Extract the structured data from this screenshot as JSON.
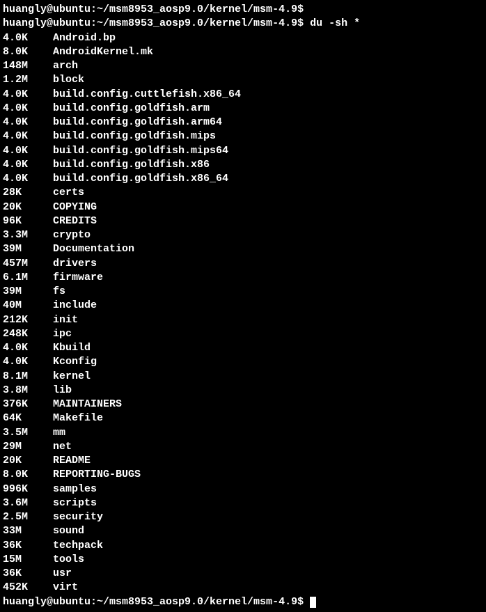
{
  "prompt1": "huangly@ubuntu:~/msm8953_aosp9.0/kernel/msm-4.9$ ",
  "prompt2": "huangly@ubuntu:~/msm8953_aosp9.0/kernel/msm-4.9$ ",
  "command": "du -sh *",
  "prompt3": "huangly@ubuntu:~/msm8953_aosp9.0/kernel/msm-4.9$ ",
  "entries": [
    {
      "size": "4.0K",
      "name": "Android.bp"
    },
    {
      "size": "8.0K",
      "name": "AndroidKernel.mk"
    },
    {
      "size": "148M",
      "name": "arch"
    },
    {
      "size": "1.2M",
      "name": "block"
    },
    {
      "size": "4.0K",
      "name": "build.config.cuttlefish.x86_64"
    },
    {
      "size": "4.0K",
      "name": "build.config.goldfish.arm"
    },
    {
      "size": "4.0K",
      "name": "build.config.goldfish.arm64"
    },
    {
      "size": "4.0K",
      "name": "build.config.goldfish.mips"
    },
    {
      "size": "4.0K",
      "name": "build.config.goldfish.mips64"
    },
    {
      "size": "4.0K",
      "name": "build.config.goldfish.x86"
    },
    {
      "size": "4.0K",
      "name": "build.config.goldfish.x86_64"
    },
    {
      "size": "28K",
      "name": "certs"
    },
    {
      "size": "20K",
      "name": "COPYING"
    },
    {
      "size": "96K",
      "name": "CREDITS"
    },
    {
      "size": "3.3M",
      "name": "crypto"
    },
    {
      "size": "39M",
      "name": "Documentation"
    },
    {
      "size": "457M",
      "name": "drivers"
    },
    {
      "size": "6.1M",
      "name": "firmware"
    },
    {
      "size": "39M",
      "name": "fs"
    },
    {
      "size": "40M",
      "name": "include"
    },
    {
      "size": "212K",
      "name": "init"
    },
    {
      "size": "248K",
      "name": "ipc"
    },
    {
      "size": "4.0K",
      "name": "Kbuild"
    },
    {
      "size": "4.0K",
      "name": "Kconfig"
    },
    {
      "size": "8.1M",
      "name": "kernel"
    },
    {
      "size": "3.8M",
      "name": "lib"
    },
    {
      "size": "376K",
      "name": "MAINTAINERS"
    },
    {
      "size": "64K",
      "name": "Makefile"
    },
    {
      "size": "3.5M",
      "name": "mm"
    },
    {
      "size": "29M",
      "name": "net"
    },
    {
      "size": "20K",
      "name": "README"
    },
    {
      "size": "8.0K",
      "name": "REPORTING-BUGS"
    },
    {
      "size": "996K",
      "name": "samples"
    },
    {
      "size": "3.6M",
      "name": "scripts"
    },
    {
      "size": "2.5M",
      "name": "security"
    },
    {
      "size": "33M",
      "name": "sound"
    },
    {
      "size": "36K",
      "name": "techpack"
    },
    {
      "size": "15M",
      "name": "tools"
    },
    {
      "size": "36K",
      "name": "usr"
    },
    {
      "size": "452K",
      "name": "virt"
    }
  ]
}
